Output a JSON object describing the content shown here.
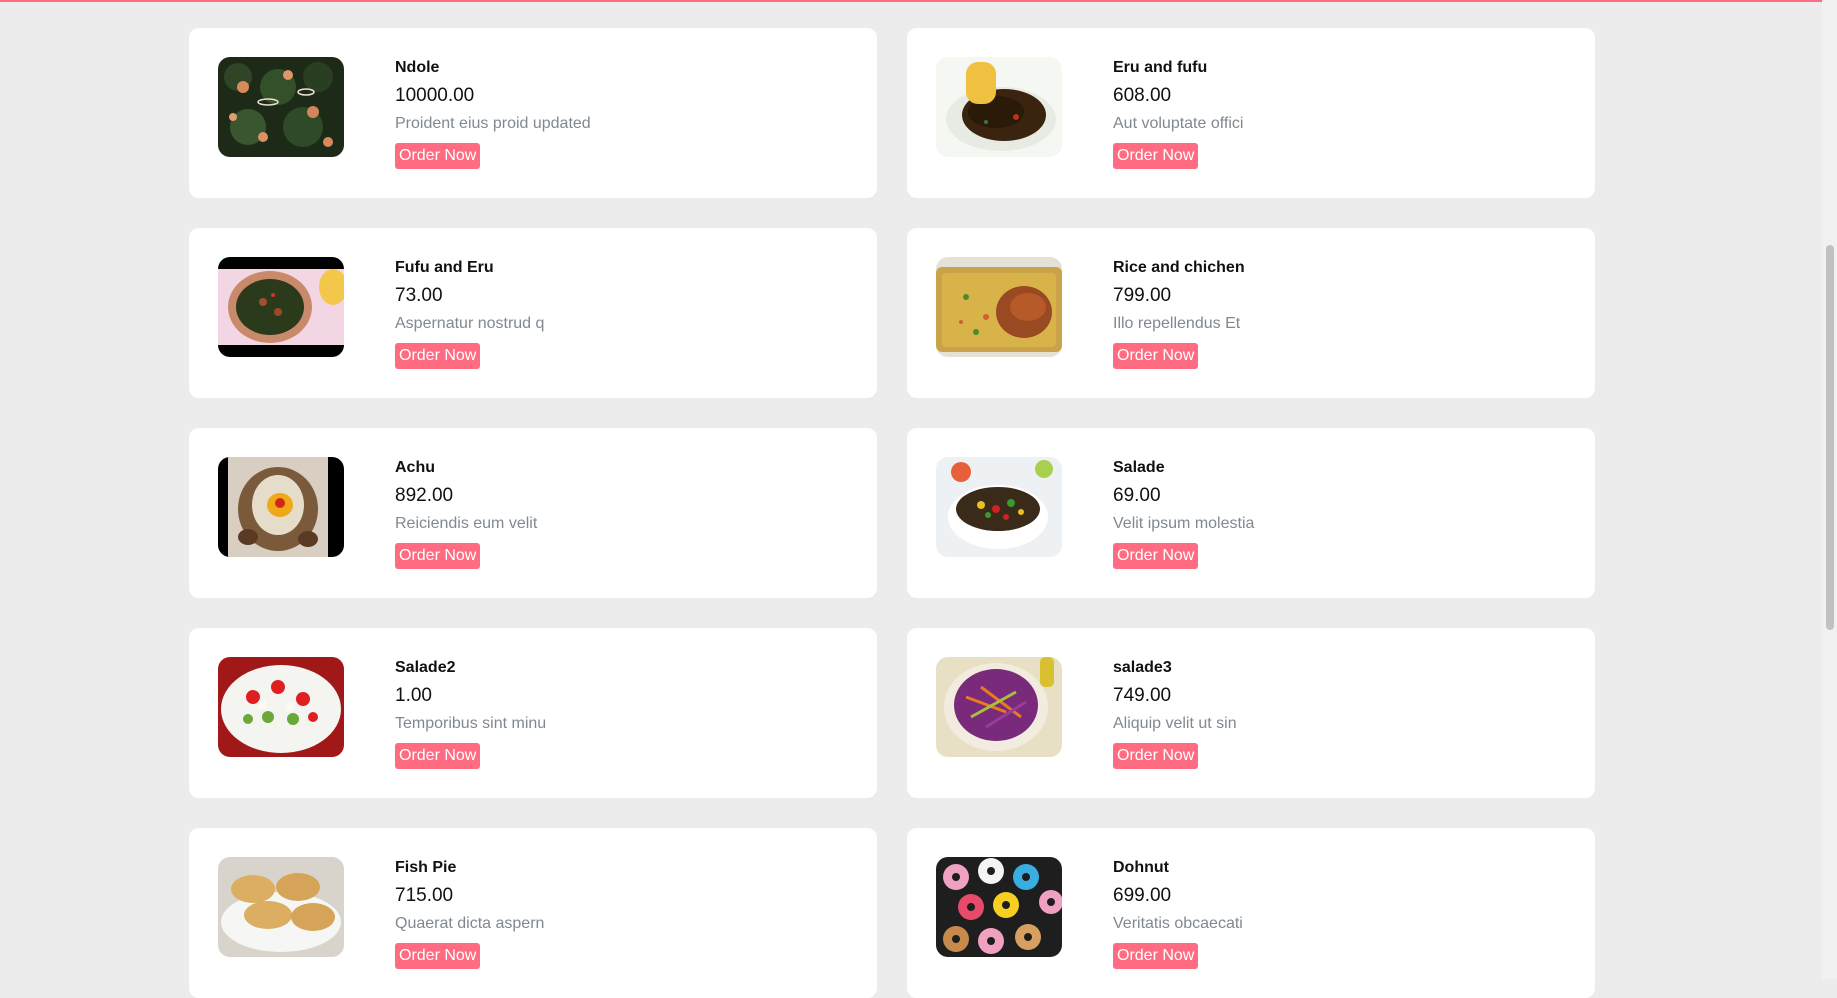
{
  "menu": {
    "order_label": "Order Now",
    "items": [
      {
        "name": "Ndole",
        "price": "10000.00",
        "description": "Proident eius proid updated",
        "image": "ndole-photo"
      },
      {
        "name": "Eru and fufu",
        "price": "608.00",
        "description": "Aut voluptate offici",
        "image": "eru-fufu-photo"
      },
      {
        "name": "Fufu and Eru",
        "price": "73.00",
        "description": "Aspernatur nostrud q",
        "image": "fufu-eru-photo"
      },
      {
        "name": "Rice and chichen",
        "price": "799.00",
        "description": "Illo repellendus Et",
        "image": "rice-chicken-photo"
      },
      {
        "name": "Achu",
        "price": "892.00",
        "description": "Reiciendis eum velit",
        "image": "achu-photo"
      },
      {
        "name": "Salade",
        "price": "69.00",
        "description": "Velit ipsum molestia",
        "image": "salad-photo"
      },
      {
        "name": "Salade2",
        "price": "1.00",
        "description": "Temporibus sint minu",
        "image": "salad2-photo"
      },
      {
        "name": "salade3",
        "price": "749.00",
        "description": "Aliquip velit ut sin",
        "image": "salad3-photo"
      },
      {
        "name": "Fish Pie",
        "price": "715.00",
        "description": "Quaerat dicta aspern",
        "image": "fish-pie-photo"
      },
      {
        "name": "Dohnut",
        "price": "699.00",
        "description": "Veritatis obcaecati",
        "image": "donut-photo"
      }
    ]
  },
  "colors": {
    "accent": "#ff6b81",
    "background": "#ececec",
    "card": "#ffffff",
    "muted_text": "#808890"
  }
}
